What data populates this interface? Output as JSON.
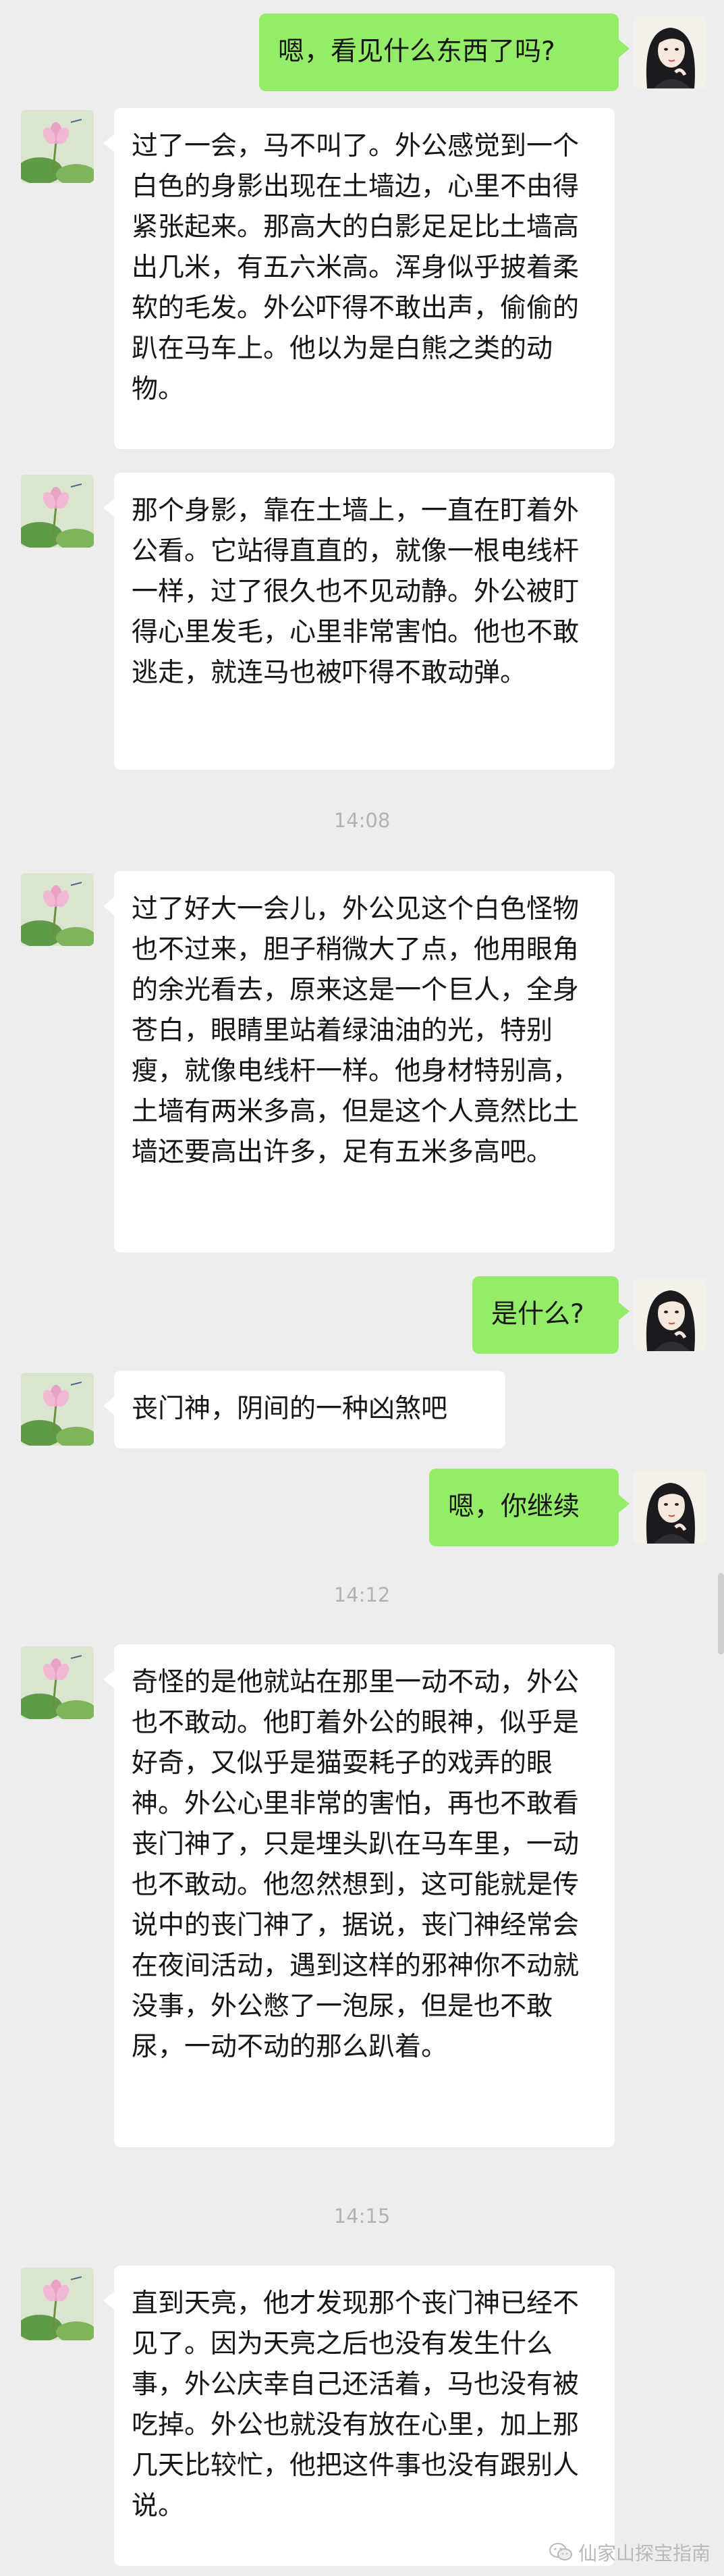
{
  "colors": {
    "background": "#ededed",
    "incoming_bubble": "#ffffff",
    "outgoing_bubble": "#95ec69",
    "timestamp": "#b2b2b2"
  },
  "icons": {
    "incoming_avatar": "lotus-flower-avatar-icon",
    "outgoing_avatar": "cartoon-woman-avatar-icon",
    "watermark": "wechat-logo-icon"
  },
  "messages": [
    {
      "side": "right",
      "text": "嗯，看见什么东西了吗?"
    },
    {
      "side": "left",
      "text": "过了一会，马不叫了。外公感觉到一个白色的身影出现在土墙边，心里不由得紧张起来。那高大的白影足足比土墙高出几米，有五六米高。浑身似乎披着柔软的毛发。外公吓得不敢出声，偷偷的趴在马车上。他以为是白熊之类的动物。"
    },
    {
      "side": "left",
      "text": "那个身影，靠在土墙上，一直在盯着外公看。它站得直直的，就像一根电线杆一样，过了很久也不见动静。外公被盯得心里发毛，心里非常害怕。他也不敢逃走，就连马也被吓得不敢动弹。"
    },
    {
      "time": "14:08"
    },
    {
      "side": "left",
      "text": "过了好大一会儿，外公见这个白色怪物也不过来，胆子稍微大了点，他用眼角的余光看去，原来这是一个巨人，全身苍白，眼睛里站着绿油油的光，特别瘦，就像电线杆一样。他身材特别高，土墙有两米多高，但是这个人竟然比土墙还要高出许多，足有五米多高吧。"
    },
    {
      "side": "right",
      "text": "是什么?"
    },
    {
      "side": "left",
      "text": "丧门神，阴间的一种凶煞吧"
    },
    {
      "side": "right",
      "text": "嗯，你继续"
    },
    {
      "time": "14:12"
    },
    {
      "side": "left",
      "text": "奇怪的是他就站在那里一动不动，外公也不敢动。他盯着外公的眼神，似乎是好奇，又似乎是猫耍耗子的戏弄的眼神。外公心里非常的害怕，再也不敢看丧门神了，只是埋头趴在马车里，一动也不敢动。他忽然想到，这可能就是传说中的丧门神了，据说，丧门神经常会在夜间活动，遇到这样的邪神你不动就没事，外公憋了一泡尿，但是也不敢尿，一动不动的那么趴着。"
    },
    {
      "time": "14:15"
    },
    {
      "side": "left",
      "text": "直到天亮，他才发现那个丧门神已经不见了。因为天亮之后也没有发生什么事，外公庆幸自己还活着，马也没有被吃掉。外公也就没有放在心里，加上那几天比较忙，他把这件事也没有跟别人说。"
    }
  ],
  "watermark_text": "仙家山探宝指南"
}
